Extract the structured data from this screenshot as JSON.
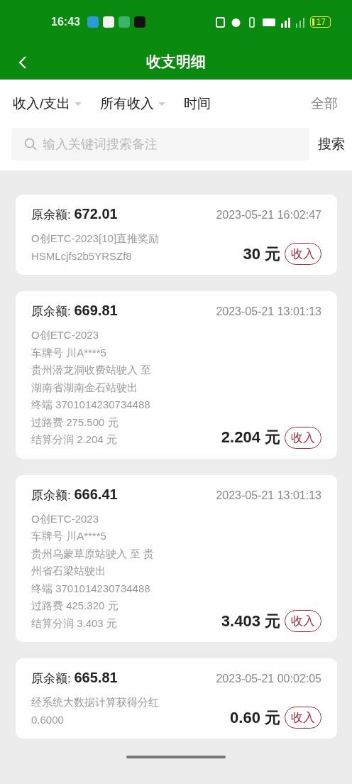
{
  "status_bar": {
    "time": "16:43",
    "battery": "17"
  },
  "header": {
    "title": "收支明细"
  },
  "filters": [
    {
      "label": "收入/支出",
      "dropdown": true
    },
    {
      "label": "所有收入",
      "dropdown": true
    },
    {
      "label": "时间",
      "dropdown": false
    }
  ],
  "filter_all": "全部",
  "search": {
    "placeholder": "输入关键词搜索备注",
    "button": "搜索"
  },
  "records": [
    {
      "balance": "原余额: **672.01**",
      "time": "2023-05-21 16:02:47",
      "lines": [
        "O创ETC-2023[10]直推奖励",
        "HSMLcjfs2b5YRSZf8"
      ],
      "amount": "30 元",
      "tag": "收入"
    },
    {
      "balance": "原余额: **669.81**",
      "time": "2023-05-21 13:01:13",
      "lines": [
        "O创ETC-2023",
        "车牌号 川A****5",
        "贵州潜龙洞收费站驶入 至",
        "湖南省湖南金石站驶出",
        "终端 3701014230734488",
        "过路费 275.500 元",
        "结算分润 2.204 元"
      ],
      "amount": "2.204 元",
      "tag": "收入"
    },
    {
      "balance": "原余额: **666.41**",
      "time": "2023-05-21 13:01:13",
      "lines": [
        "O创ETC-2023",
        "车牌号 川A****5",
        "贵州乌蒙草原站驶入 至 贵",
        "州省石梁站驶出",
        "终端 3701014230734488",
        "过路费 425.320 元",
        "结算分润 3.403 元"
      ],
      "amount": "3.403 元",
      "tag": "收入"
    },
    {
      "balance": "原余额: **665.81**",
      "time": "2023-05-21 00:02:05",
      "lines": [
        "经系统大数据计算获得分红",
        "0.6000"
      ],
      "amount": "0.60 元",
      "tag": "收入"
    }
  ]
}
